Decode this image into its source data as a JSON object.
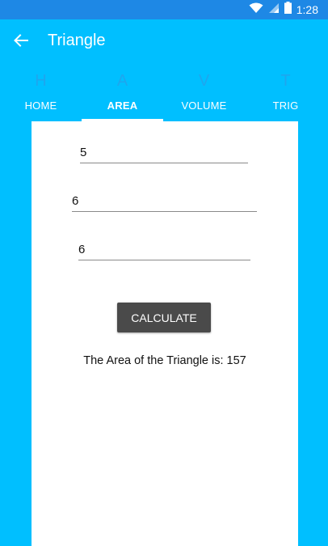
{
  "status_bar": {
    "time": "1:28",
    "icons": [
      "wifi-icon",
      "signal-icon",
      "battery-icon"
    ],
    "color": "#1E88E5"
  },
  "app_bar": {
    "title": "Triangle",
    "back_icon": "arrow-left-icon",
    "color": "#00BFFF"
  },
  "tabs": [
    {
      "glyph": "H",
      "label": "HOME",
      "active": false
    },
    {
      "glyph": "A",
      "label": "AREA",
      "active": true
    },
    {
      "glyph": "V",
      "label": "VOLUME",
      "active": false
    },
    {
      "glyph": "T",
      "label": "TRIG",
      "active": false
    }
  ],
  "form": {
    "inputs": [
      {
        "value": "5"
      },
      {
        "value": "6"
      },
      {
        "value": "6"
      }
    ],
    "calculate_label": "CALCULATE",
    "result_text": "The Area of the Triangle is: 157"
  },
  "colors": {
    "accent": "#00BFFF",
    "button": "#4A4A4A",
    "tab_glyph": "#1EA6EE"
  }
}
